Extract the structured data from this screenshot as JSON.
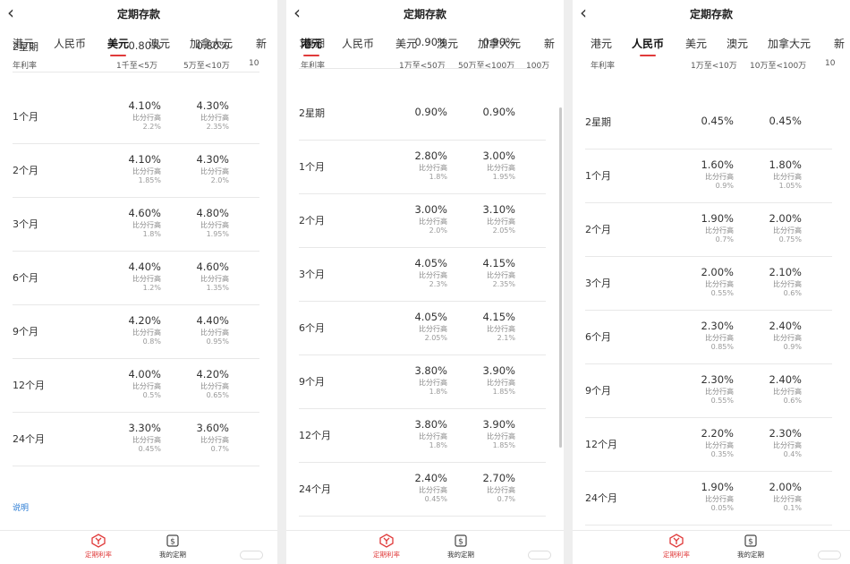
{
  "colors": {
    "accent": "#e03a3a",
    "link": "#2a7bd4"
  },
  "panels": [
    {
      "title": "定期存款",
      "tabs": [
        "港元",
        "人民币",
        "美元",
        "澳元",
        "加拿大元",
        "新"
      ],
      "active_tab": 2,
      "header": {
        "label": "年利率",
        "col1": "1千至<5万",
        "col2": "5万至<10万",
        "col3": "10"
      },
      "rows": [
        {
          "term": "2星期",
          "v1": "0.80%",
          "v2": "0.80%"
        },
        {
          "term": "1个月",
          "v1": "4.10%",
          "c1": "比分行高",
          "d1": "2.2%",
          "v2": "4.30%",
          "c2": "比分行高",
          "d2": "2.35%"
        },
        {
          "term": "2个月",
          "v1": "4.10%",
          "c1": "比分行高",
          "d1": "1.85%",
          "v2": "4.30%",
          "c2": "比分行高",
          "d2": "2.0%"
        },
        {
          "term": "3个月",
          "v1": "4.60%",
          "c1": "比分行高",
          "d1": "1.8%",
          "v2": "4.80%",
          "c2": "比分行高",
          "d2": "1.95%"
        },
        {
          "term": "6个月",
          "v1": "4.40%",
          "c1": "比分行高",
          "d1": "1.2%",
          "v2": "4.60%",
          "c2": "比分行高",
          "d2": "1.35%"
        },
        {
          "term": "9个月",
          "v1": "4.20%",
          "c1": "比分行高",
          "d1": "0.8%",
          "v2": "4.40%",
          "c2": "比分行高",
          "d2": "0.95%"
        },
        {
          "term": "12个月",
          "v1": "4.00%",
          "c1": "比分行高",
          "d1": "0.5%",
          "v2": "4.20%",
          "c2": "比分行高",
          "d2": "0.65%"
        },
        {
          "term": "24个月",
          "v1": "3.30%",
          "c1": "比分行高",
          "d1": "0.45%",
          "v2": "3.60%",
          "c2": "比分行高",
          "d2": "0.7%"
        }
      ],
      "link": "说明",
      "nav": [
        {
          "label": "定期利率"
        },
        {
          "label": "我的定期"
        }
      ]
    },
    {
      "title": "定期存款",
      "tabs": [
        "港元",
        "人民币",
        "美元",
        "澳元",
        "加拿大元",
        "新"
      ],
      "active_tab": 0,
      "header": {
        "label": "年利率",
        "col1": "1万至<50万",
        "col2": "50万至<100万",
        "col3": "100万"
      },
      "rows": [
        {
          "term": "1星期",
          "v1": "0.90%",
          "v2": "0.90%"
        },
        {
          "term": "2星期",
          "v1": "0.90%",
          "v2": "0.90%"
        },
        {
          "term": "1个月",
          "v1": "2.80%",
          "c1": "比分行高",
          "d1": "1.8%",
          "v2": "3.00%",
          "c2": "比分行高",
          "d2": "1.95%"
        },
        {
          "term": "2个月",
          "v1": "3.00%",
          "c1": "比分行高",
          "d1": "2.0%",
          "v2": "3.10%",
          "c2": "比分行高",
          "d2": "2.05%"
        },
        {
          "term": "3个月",
          "v1": "4.05%",
          "c1": "比分行高",
          "d1": "2.3%",
          "v2": "4.15%",
          "c2": "比分行高",
          "d2": "2.35%"
        },
        {
          "term": "6个月",
          "v1": "4.05%",
          "c1": "比分行高",
          "d1": "2.05%",
          "v2": "4.15%",
          "c2": "比分行高",
          "d2": "2.1%"
        },
        {
          "term": "9个月",
          "v1": "3.80%",
          "c1": "比分行高",
          "d1": "1.8%",
          "v2": "3.90%",
          "c2": "比分行高",
          "d2": "1.85%"
        },
        {
          "term": "12个月",
          "v1": "3.80%",
          "c1": "比分行高",
          "d1": "1.8%",
          "v2": "3.90%",
          "c2": "比分行高",
          "d2": "1.85%"
        },
        {
          "term": "24个月",
          "v1": "2.40%",
          "c1": "比分行高",
          "d1": "0.45%",
          "v2": "2.70%",
          "c2": "比分行高",
          "d2": "0.7%"
        }
      ],
      "nav": [
        {
          "label": "定期利率"
        },
        {
          "label": "我的定期"
        }
      ]
    },
    {
      "title": "定期存款",
      "tabs": [
        "港元",
        "人民币",
        "美元",
        "澳元",
        "加拿大元",
        "新"
      ],
      "active_tab": 1,
      "header": {
        "label": "年利率",
        "col1": "1万至<10万",
        "col2": "10万至<100万",
        "col3": "10"
      },
      "rows": [
        {
          "term": "2星期",
          "v1": "0.45%",
          "v2": "0.45%"
        },
        {
          "term": "1个月",
          "v1": "1.60%",
          "c1": "比分行高",
          "d1": "0.9%",
          "v2": "1.80%",
          "c2": "比分行高",
          "d2": "1.05%"
        },
        {
          "term": "2个月",
          "v1": "1.90%",
          "c1": "比分行高",
          "d1": "0.7%",
          "v2": "2.00%",
          "c2": "比分行高",
          "d2": "0.75%"
        },
        {
          "term": "3个月",
          "v1": "2.00%",
          "c1": "比分行高",
          "d1": "0.55%",
          "v2": "2.10%",
          "c2": "比分行高",
          "d2": "0.6%"
        },
        {
          "term": "6个月",
          "v1": "2.30%",
          "c1": "比分行高",
          "d1": "0.85%",
          "v2": "2.40%",
          "c2": "比分行高",
          "d2": "0.9%"
        },
        {
          "term": "9个月",
          "v1": "2.30%",
          "c1": "比分行高",
          "d1": "0.55%",
          "v2": "2.40%",
          "c2": "比分行高",
          "d2": "0.6%"
        },
        {
          "term": "12个月",
          "v1": "2.20%",
          "c1": "比分行高",
          "d1": "0.35%",
          "v2": "2.30%",
          "c2": "比分行高",
          "d2": "0.4%"
        },
        {
          "term": "24个月",
          "v1": "1.90%",
          "c1": "比分行高",
          "d1": "0.05%",
          "v2": "2.00%",
          "c2": "比分行高",
          "d2": "0.1%"
        }
      ],
      "nav": [
        {
          "label": "定期利率"
        },
        {
          "label": "我的定期"
        }
      ]
    }
  ]
}
